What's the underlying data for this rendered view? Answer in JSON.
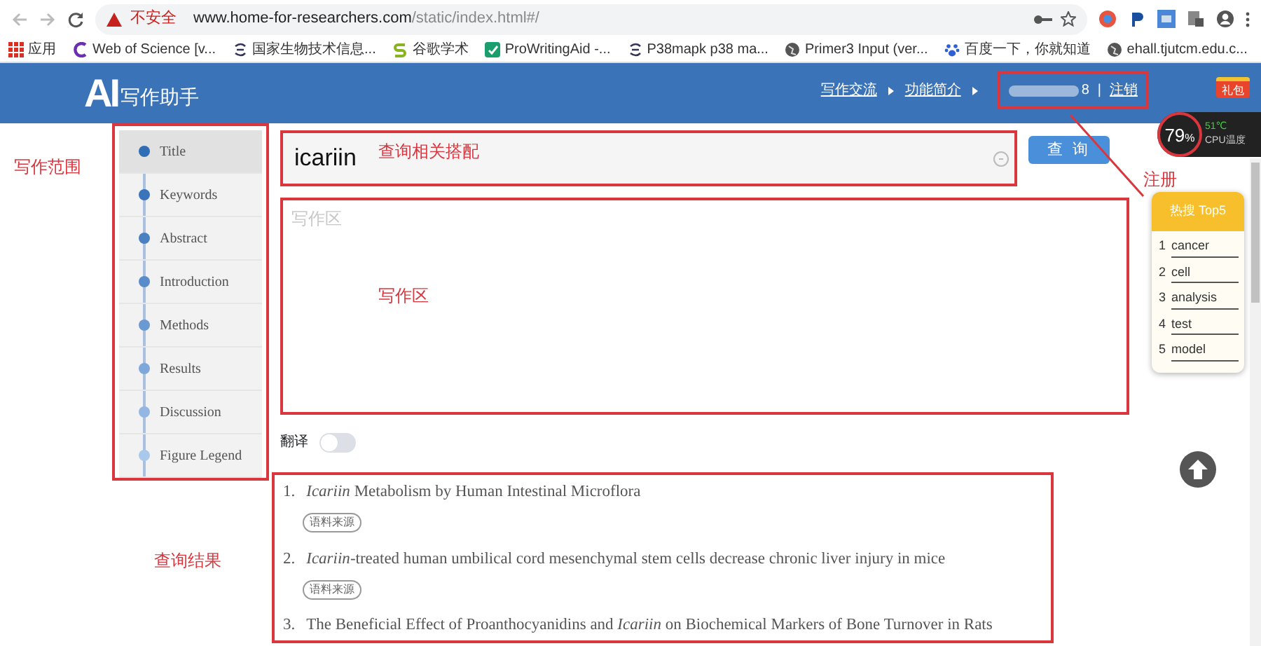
{
  "browser": {
    "security": "不安全",
    "url_host": "www.home-for-researchers.com",
    "url_path": "/static/index.html#/",
    "bookmarks": [
      {
        "label": "应用",
        "kind": "apps"
      },
      {
        "label": "Web of Science [v...",
        "kind": "wos"
      },
      {
        "label": "国家生物技术信息...",
        "kind": "ncbi"
      },
      {
        "label": "谷歌学术",
        "kind": "scholar"
      },
      {
        "label": "ProWritingAid -...",
        "kind": "pwa"
      },
      {
        "label": "P38mapk p38 ma...",
        "kind": "ncbi"
      },
      {
        "label": "Primer3 Input (ver...",
        "kind": "globe"
      },
      {
        "label": "百度一下，你就知道",
        "kind": "baidu"
      },
      {
        "label": "ehall.tjutcm.edu.c...",
        "kind": "globe"
      }
    ]
  },
  "header": {
    "logo_mark": "AI",
    "logo_text": "写作助手",
    "nav": [
      "写作交流",
      "功能简介"
    ],
    "user_suffix": "8",
    "separator": "|",
    "logout": "注销",
    "gift": "礼包"
  },
  "cpu_widget": {
    "percent": "79",
    "unit": "%",
    "temp": "51℃",
    "label": "CPU温度"
  },
  "sidebar": {
    "items": [
      {
        "label": "Title",
        "selected": true,
        "color": "#2f6db5"
      },
      {
        "label": "Keywords",
        "selected": false,
        "color": "#3a75bb"
      },
      {
        "label": "Abstract",
        "selected": false,
        "color": "#4a80c2"
      },
      {
        "label": "Introduction",
        "selected": false,
        "color": "#5a8cca"
      },
      {
        "label": "Methods",
        "selected": false,
        "color": "#6b99d2"
      },
      {
        "label": "Results",
        "selected": false,
        "color": "#7ea7da"
      },
      {
        "label": "Discussion",
        "selected": false,
        "color": "#93b7e2"
      },
      {
        "label": "Figure Legend",
        "selected": false,
        "color": "#a9c8ec"
      }
    ]
  },
  "search": {
    "value": "icariin",
    "button": "查 询"
  },
  "editor": {
    "placeholder": "写作区"
  },
  "translate": {
    "label": "翻译",
    "on": false
  },
  "results": [
    {
      "number": "1.",
      "title": "*Icariin* Metabolism by Human Intestinal Microflora",
      "tag": "语料来源"
    },
    {
      "number": "2.",
      "title": "*Icariin*-treated human umbilical cord mesenchymal stem cells decrease chronic liver injury in mice",
      "tag": "语料来源"
    },
    {
      "number": "3.",
      "title": "The Beneficial Effect of Proanthocyanidins and *Icariin* on Biochemical Markers of Bone Turnover in Rats"
    }
  ],
  "hot_search": {
    "title": "热搜 Top5",
    "items": [
      {
        "rank": "1",
        "term": "cancer"
      },
      {
        "rank": "2",
        "term": "cell"
      },
      {
        "rank": "3",
        "term": "analysis"
      },
      {
        "rank": "4",
        "term": "test"
      },
      {
        "rank": "5",
        "term": "model"
      }
    ]
  },
  "annotations": {
    "scope": "写作范围",
    "query": "查询相关搭配",
    "editor": "写作区",
    "register": "注册",
    "results": "查询结果"
  }
}
